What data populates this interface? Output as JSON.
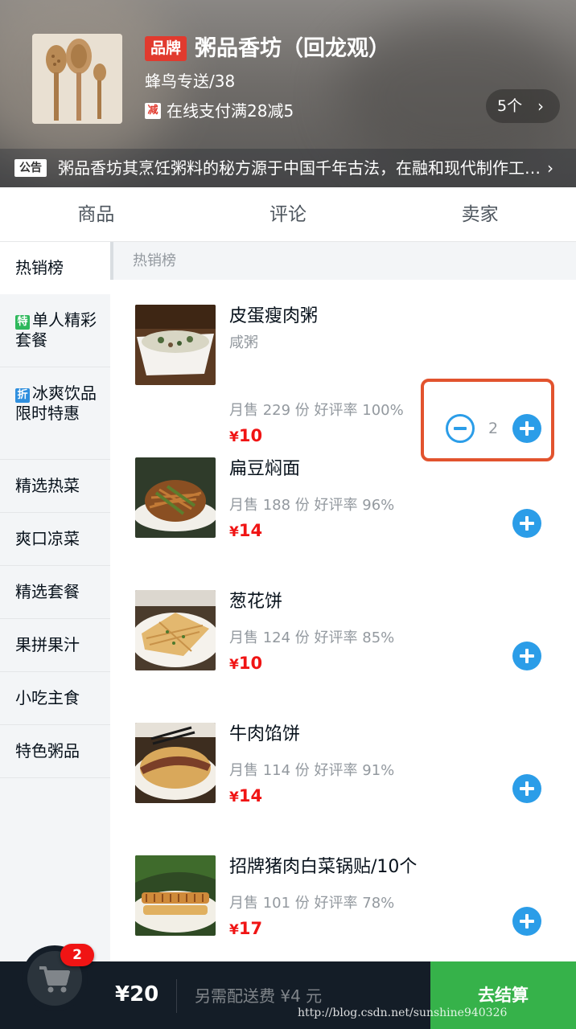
{
  "header": {
    "brand_badge": "品牌",
    "shop_name": "粥品香坊（回龙观）",
    "delivery": "蜂鸟专送/38",
    "promo_icon": "减",
    "promo_text": "在线支付满28减5",
    "count_pill": "5个",
    "notice_badge": "公告",
    "notice_text": "粥品香坊其烹饪粥料的秘方源于中国千年古法，在融和现代制作工艺，由世界烹饪大师屈浩先生领衔研发。"
  },
  "tabs": [
    "商品",
    "评论",
    "卖家"
  ],
  "categories": [
    {
      "label": "热销榜",
      "badge": null
    },
    {
      "label": "单人精彩套餐",
      "badge": "特"
    },
    {
      "label": "冰爽饮品限时特惠",
      "badge": "折"
    },
    {
      "label": "精选热菜",
      "badge": null
    },
    {
      "label": "爽口凉菜",
      "badge": null
    },
    {
      "label": "精选套餐",
      "badge": null
    },
    {
      "label": "果拼果汁",
      "badge": null
    },
    {
      "label": "小吃主食",
      "badge": null
    },
    {
      "label": "特色粥品",
      "badge": null
    }
  ],
  "section_title": "热销榜",
  "foods": [
    {
      "name": "皮蛋瘦肉粥",
      "desc": "咸粥",
      "stats": "月售 229 份   好评率 100%",
      "price": "10",
      "qty": "2"
    },
    {
      "name": "扁豆焖面",
      "desc": "",
      "stats": "月售 188 份   好评率 96%",
      "price": "14"
    },
    {
      "name": "葱花饼",
      "desc": "",
      "stats": "月售 124 份   好评率 85%",
      "price": "10"
    },
    {
      "name": "牛肉馅饼",
      "desc": "",
      "stats": "月售 114 份   好评率 91%",
      "price": "14"
    },
    {
      "name": "招牌猪肉白菜锅贴/10个",
      "desc": "",
      "stats": "月售 101 份   好评率 78%",
      "price": "17"
    }
  ],
  "currency": "¥",
  "cart": {
    "count": "2",
    "total": "¥20",
    "fee": "另需配送费 ¥4 元",
    "checkout": "去结算",
    "icon": "cart-icon"
  },
  "watermark": "http://blog.csdn.net/sunshine940326",
  "colors": {
    "accent": "#2b9de8",
    "price": "#f01414",
    "checkout": "#36b24a",
    "highlight": "#e2532e"
  }
}
